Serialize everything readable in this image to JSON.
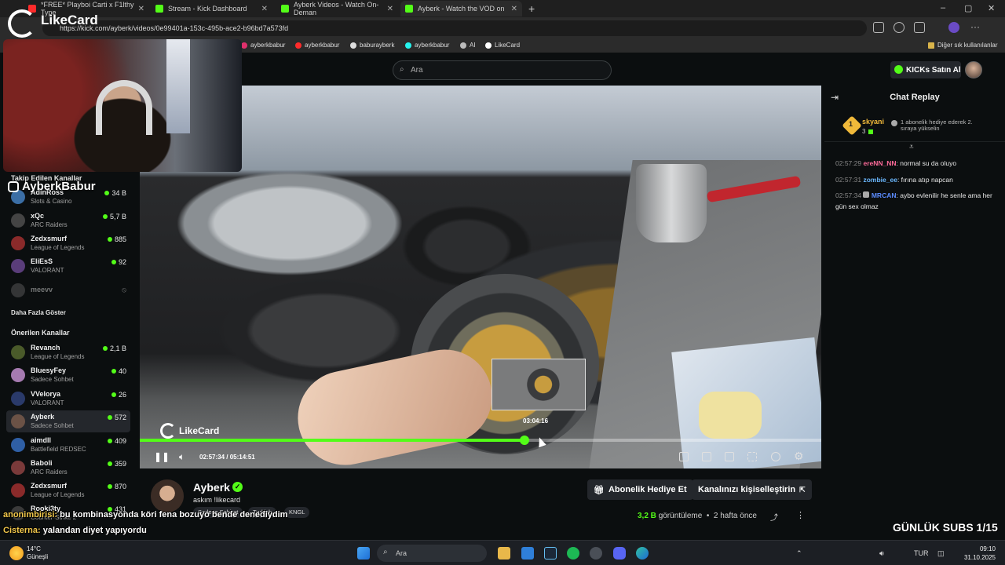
{
  "browser": {
    "tabs": [
      {
        "title": "*FREE* Playboi Carti x F1lthy Type",
        "icon": "youtube-icon",
        "active": false
      },
      {
        "title": "Stream - Kick Dashboard",
        "icon": "kick-icon",
        "active": false
      },
      {
        "title": "Ayberk Videos - Watch On-Deman",
        "icon": "kick-icon",
        "active": false
      },
      {
        "title": "Ayberk - Watch the VOD on",
        "icon": "kick-icon",
        "active": true
      }
    ],
    "url": "https://kick.com/ayberk/videos/0e99401a-153c-495b-ace2-b96bd7a573fd",
    "bookmarks": [
      "ayberkbabur",
      "ayberkbabur",
      "baburayberk",
      "ayberkbabur",
      "AI",
      "LikeCard"
    ],
    "other_bookmarks": "Diğer sık kullanılanlar"
  },
  "header": {
    "search_placeholder": "Ara",
    "buy_kicks": "KICKs Satın Al"
  },
  "overlay": {
    "logo_text": "LikeCard",
    "instagram_handle": "AyberkBabur",
    "video_logo": "LikeCard",
    "chat_line1_user": "anonimbirisi:",
    "chat_line1_text": "bu kombinasyonda köri fena bozuyo bende denediydim",
    "chat_line2_user": "Cisterna:",
    "chat_line2_text": "yalandan diyet yapıyordu",
    "subs_goal": "GÜNLÜK SUBS 1/15"
  },
  "sidebar": {
    "followed_title": "Takip Edilen Kanallar",
    "followed": [
      {
        "name": "AdinRoss",
        "game": "Slots & Casino",
        "viewers": "34 B",
        "color": "#3b6ea5"
      },
      {
        "name": "xQc",
        "game": "ARC Raiders",
        "viewers": "5,7 B",
        "color": "#2a2a2a"
      },
      {
        "name": "Zedxsmurf",
        "game": "League of Legends",
        "viewers": "885",
        "color": "#8a2a2a"
      },
      {
        "name": "EliEsS",
        "game": "VALORANT",
        "viewers": "92",
        "color": "#5a3d7a"
      },
      {
        "name": "meevv",
        "game": "",
        "viewers": "",
        "color": "#666"
      }
    ],
    "show_more": "Daha Fazla Göster",
    "recommended_title": "Önerilen Kanallar",
    "recommended": [
      {
        "name": "Revanch",
        "game": "League of Legends",
        "viewers": "2,1 B",
        "color": "#4a5a2a"
      },
      {
        "name": "BluesyFey",
        "game": "Sadece Sohbet",
        "viewers": "40",
        "color": "#a57ab0"
      },
      {
        "name": "VVelorya",
        "game": "VALORANT",
        "viewers": "26",
        "color": "#2a3a6a"
      },
      {
        "name": "Ayberk",
        "game": "Sadece Sohbet",
        "viewers": "572",
        "color": "#6b5246"
      },
      {
        "name": "aimdll",
        "game": "Battlefield REDSEC",
        "viewers": "409",
        "color": "#2f5fa5"
      },
      {
        "name": "Baboli",
        "game": "ARC Raiders",
        "viewers": "359",
        "color": "#7a3a3a"
      },
      {
        "name": "Zedxsmurf",
        "game": "League of Legends",
        "viewers": "870",
        "color": "#8a2a2a"
      },
      {
        "name": "Rooki3ty",
        "game": "Counter-Strike 2",
        "viewers": "431",
        "color": "#3a3a3a"
      }
    ]
  },
  "player": {
    "preview_time": "03:04:16",
    "current_time": "02:57:34",
    "duration": "05:14:51",
    "progress": 0.562
  },
  "chat": {
    "title": "Chat Replay",
    "pinned_user": "skyani",
    "pinned_count": "3",
    "pinned_rank": "1",
    "pinned_text": "1 abonelik hediye ederek 2. sıraya yükselin",
    "messages": [
      {
        "time": "02:57:29",
        "user": "ereNN_NN",
        "color": "#ff6b9a",
        "text": "normal su da oluyo"
      },
      {
        "time": "02:57:31",
        "user": "zombie_ee",
        "color": "#6bb8ff",
        "text": "fırına atıp napcan"
      },
      {
        "time": "02:57:34",
        "user": "MRCAN",
        "color": "#5b8cff",
        "text": "aybo evlenilir he senle ama her gün sex olmaz"
      }
    ]
  },
  "channel": {
    "name": "Ayberk",
    "title": "askım !likecard",
    "tags": [
      "Sadece Sohbet",
      "Turkish",
      "KNGL"
    ],
    "gift_button": "Abonelik Hediye Et",
    "customize_button": "Kanalınızı kişiselleştirin",
    "views_count": "3,2 B",
    "views_label": "görüntüleme",
    "age": "2 hafta önce"
  },
  "taskbar": {
    "temp": "14°C",
    "weather": "Güneşli",
    "search": "Ara",
    "lang": "TUR",
    "time": "09:10",
    "date": "31.10.2025"
  }
}
